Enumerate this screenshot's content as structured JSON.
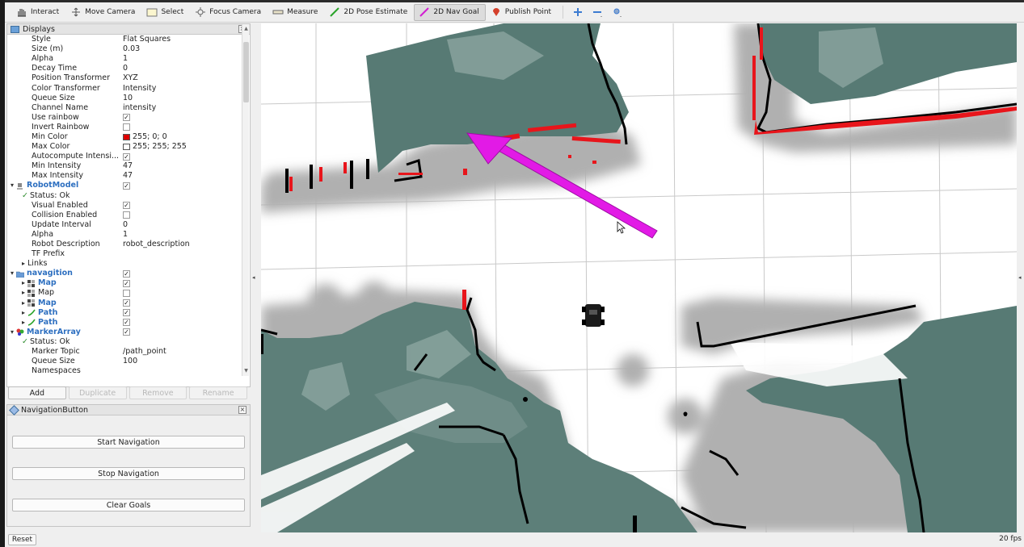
{
  "toolbar": {
    "tools": [
      {
        "label": "Interact",
        "icon": "hand-icon"
      },
      {
        "label": "Move Camera",
        "icon": "move-camera-icon"
      },
      {
        "label": "Select",
        "icon": "select-icon"
      },
      {
        "label": "Focus Camera",
        "icon": "focus-camera-icon"
      },
      {
        "label": "Measure",
        "icon": "measure-icon"
      },
      {
        "label": "2D Pose Estimate",
        "icon": "pose-estimate-icon"
      },
      {
        "label": "2D Nav Goal",
        "icon": "nav-goal-icon"
      },
      {
        "label": "Publish Point",
        "icon": "publish-point-icon"
      }
    ],
    "active_tool": "2D Nav Goal"
  },
  "displays": {
    "title": "Displays",
    "rows": [
      {
        "key": "Style",
        "value": "Flat Squares"
      },
      {
        "key": "Size (m)",
        "value": "0.03"
      },
      {
        "key": "Alpha",
        "value": "1"
      },
      {
        "key": "Decay Time",
        "value": "0"
      },
      {
        "key": "Position Transformer",
        "value": "XYZ"
      },
      {
        "key": "Color Transformer",
        "value": "Intensity"
      },
      {
        "key": "Queue Size",
        "value": "10"
      },
      {
        "key": "Channel Name",
        "value": "intensity"
      },
      {
        "key": "Use rainbow",
        "check": true
      },
      {
        "key": "Invert Rainbow",
        "check": false
      },
      {
        "key": "Min Color",
        "value": "255; 0; 0",
        "swatch": "#e00000"
      },
      {
        "key": "Max Color",
        "value": "255; 255; 255",
        "swatch": "#ffffff"
      },
      {
        "key": "Autocompute Intensi...",
        "check": true
      },
      {
        "key": "Min Intensity",
        "value": "47"
      },
      {
        "key": "Max Intensity",
        "value": "47"
      },
      {
        "key": "RobotModel",
        "check": true,
        "group": true,
        "icon": "robot-model-icon",
        "expanded": true,
        "indent": 0
      },
      {
        "key": "Status: Ok",
        "status": true,
        "indent": 1
      },
      {
        "key": "Visual Enabled",
        "check": true
      },
      {
        "key": "Collision Enabled",
        "check": false
      },
      {
        "key": "Update Interval",
        "value": "0"
      },
      {
        "key": "Alpha",
        "value": "1"
      },
      {
        "key": "Robot Description",
        "value": "robot_description"
      },
      {
        "key": "TF Prefix",
        "value": ""
      },
      {
        "key": "Links",
        "collapsed": true,
        "indent": 1
      },
      {
        "key": "navagition",
        "check": true,
        "group": true,
        "icon": "folder-icon",
        "expanded": true,
        "indent": 0
      },
      {
        "key": "Map",
        "check": true,
        "group": true,
        "icon": "map-icon",
        "collapsed": true,
        "indent": 1
      },
      {
        "key": "Map",
        "check": false,
        "icon": "map-icon",
        "collapsed": true,
        "indent": 1
      },
      {
        "key": "Map",
        "check": true,
        "group": true,
        "icon": "map-icon",
        "collapsed": true,
        "indent": 1
      },
      {
        "key": "Path",
        "check": true,
        "group": true,
        "icon": "path-icon",
        "collapsed": true,
        "indent": 1
      },
      {
        "key": "Path",
        "check": true,
        "group": true,
        "icon": "path-icon",
        "collapsed": true,
        "indent": 1
      },
      {
        "key": "MarkerArray",
        "check": true,
        "group": true,
        "icon": "marker-array-icon",
        "expanded": true,
        "indent": 0
      },
      {
        "key": "Status: Ok",
        "status": true,
        "indent": 1
      },
      {
        "key": "Marker Topic",
        "value": "/path_point"
      },
      {
        "key": "Queue Size",
        "value": "100"
      },
      {
        "key": "Namespaces",
        "value": ""
      }
    ],
    "buttons": [
      "Add",
      "Duplicate",
      "Remove",
      "Rename"
    ]
  },
  "navigation_panel": {
    "title": "NavigationButton",
    "buttons": [
      "Start Navigation",
      "Stop Navigation",
      "Clear Goals"
    ]
  },
  "reset_label": "Reset",
  "fps": "20 fps",
  "colors": {
    "laser_points": "#e8151b",
    "goal_arrow": "#e21ae6",
    "occupied": "#000000",
    "unknown": "#577a74",
    "costmap": "#b3b3b3",
    "free": "#ffffff"
  }
}
